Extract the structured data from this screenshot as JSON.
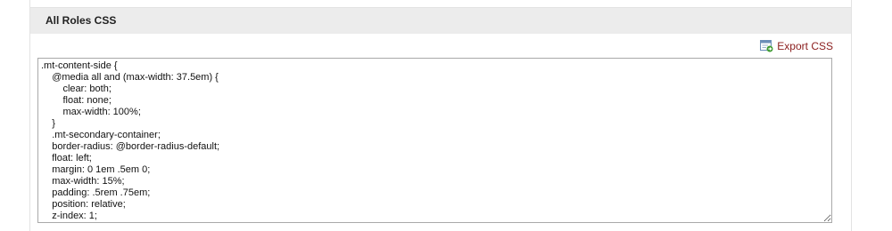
{
  "panel": {
    "title": "All Roles CSS"
  },
  "export": {
    "label": "Export CSS",
    "icon": "export-css-icon"
  },
  "editor": {
    "content": ".mt-content-side {\n    @media all and (max-width: 37.5em) {\n        clear: both;\n        float: none;\n        max-width: 100%;\n    }\n    .mt-secondary-container;\n    border-radius: @border-radius-default;\n    float: left;\n    margin: 0 1em .5em 0;\n    max-width: 15%;\n    padding: .5rem .75em;\n    position: relative;\n    z-index: 1;"
  },
  "colors": {
    "link": "#8a1c1c",
    "header_bg": "#ececec"
  }
}
